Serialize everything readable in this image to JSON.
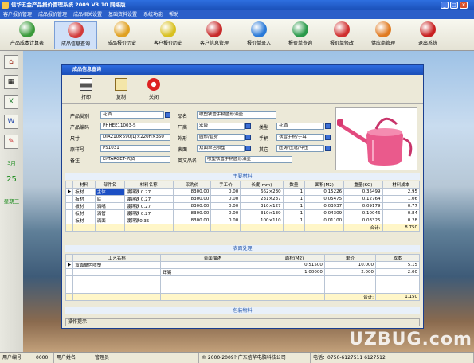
{
  "window": {
    "title": "信华五金产品报价管理系统 2009 V3.10 网络版"
  },
  "menu": [
    "客户报价管理",
    "成品报价管理",
    "成品相关设置",
    "基础资料设置",
    "系统功能",
    "帮助"
  ],
  "toolbar": [
    {
      "label": "产品成本计算表",
      "color": "#3a9a3a"
    },
    {
      "label": "成品信息查询",
      "color": "#d23a3a"
    },
    {
      "label": "成品报价历史",
      "color": "#e0a020"
    },
    {
      "label": "客户报价历史",
      "color": "#d8c020"
    },
    {
      "label": "客户信息管理",
      "color": "#c82a2a"
    },
    {
      "label": "报价单录入",
      "color": "#2a7ad8"
    },
    {
      "label": "报价单查询",
      "color": "#2a9a4a"
    },
    {
      "label": "报价单修改",
      "color": "#d03030"
    },
    {
      "label": "供应商管理",
      "color": "#e07a20"
    },
    {
      "label": "退出系统",
      "color": "#c82020"
    }
  ],
  "left": {
    "month": "3月",
    "day": "25",
    "weekday": "星期三"
  },
  "dialog": {
    "title": "成品信息查询",
    "buttons": [
      "打印",
      "复制",
      "关闭"
    ],
    "form": {
      "category_label": "产品类别",
      "category": "花洒",
      "code_label": "产品编码",
      "code": "PHHEE11003-S",
      "size_label": "尺寸",
      "size": "DIA210×590(L)×220H×350",
      "orig_label": "原样号",
      "orig": "PS1031",
      "remark_label": "备注",
      "remark": "LY-TARGET-大货",
      "name_label": "品名",
      "name": "喷塑铁管手柄圆形洒壶",
      "factory_label": "厂商",
      "factory": "宏康",
      "shape_label": "外形",
      "shape": "圆形/直身",
      "surface_label": "表面",
      "surface": "双面单色喷塑",
      "en_label": "英文品名",
      "en": "喷塑铁管手柄圆形洒壶",
      "type_label": "类型",
      "type": "花洒",
      "handle_label": "手柄",
      "handle": "铁管手柄/手耳",
      "other_label": "其它",
      "other": "压铸/压冠/冲压"
    },
    "materials": {
      "title": "主要材料",
      "columns": [
        "材料",
        "部件名",
        "材料名称",
        "采购价",
        "手工价",
        "长度(mm)",
        "数量",
        "面积(M2)",
        "重量(KG)",
        "材料成本"
      ],
      "rows": [
        [
          "板材",
          "主体",
          "镀锌铁 0.27",
          "8300.00",
          "0.00",
          "662×230",
          "1",
          "0.15226",
          "0.35499",
          "2.95"
        ],
        [
          "板材",
          "底",
          "镀锌铁 0.27",
          "8300.00",
          "0.00",
          "231×237",
          "1",
          "0.05475",
          "0.12764",
          "1.06"
        ],
        [
          "板材",
          "洒嘴",
          "镀锌铁 0.27",
          "8300.00",
          "0.00",
          "310×127",
          "1",
          "0.03937",
          "0.09179",
          "0.77"
        ],
        [
          "板材",
          "洒管",
          "镀锌铁 0.27",
          "8300.00",
          "0.00",
          "310×139",
          "1",
          "0.04309",
          "0.10046",
          "0.84"
        ],
        [
          "板材",
          "洒面",
          "镀锌铁0.35",
          "8300.00",
          "0.00",
          "100×110",
          "1",
          "0.01100",
          "0.03325",
          "0.28"
        ]
      ],
      "total_label": "合计:",
      "total": "8.750"
    },
    "surface_tbl": {
      "title": "表面处理",
      "columns": [
        "工艺名称",
        "表面描述",
        "面积(M2)",
        "单价",
        "成本"
      ],
      "rows": [
        [
          "双面单色喷塑",
          "",
          "0.51500",
          "10.000",
          "5.15"
        ],
        [
          "",
          "焊锡",
          "1.00000",
          "2.000",
          "2.00"
        ]
      ],
      "total_label": "合计:",
      "total": "1.150"
    },
    "packing_title": "包装物料",
    "hint": "操作提示"
  },
  "status": {
    "user_code_label": "用户编号",
    "user_code": "0000",
    "user_name_label": "用户姓名",
    "user_name": "管理员",
    "copyright": "© 2000-2009?  广东信华电脑科技公司",
    "phone": "电话：0750-6127511  6127512"
  },
  "watermark": "UZBUG.com"
}
